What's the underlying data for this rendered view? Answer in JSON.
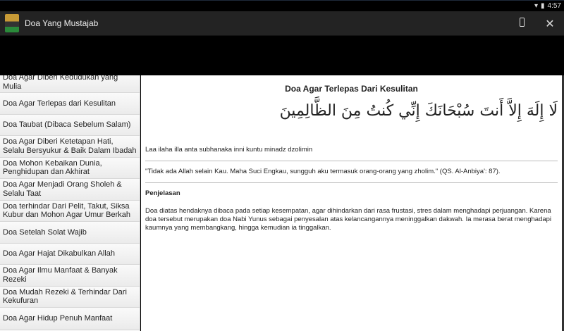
{
  "status": {
    "time": "4:57"
  },
  "app": {
    "title": "Doa Yang Mustajab"
  },
  "sidebar": {
    "items": [
      "Doa Agar Diberi Kedudukan yang Mulia",
      "Doa Agar Terlepas dari Kesulitan",
      "Doa Taubat (Dibaca Sebelum Salam)",
      "Doa Agar Diberi Ketetapan Hati, Selalu Bersyukur & Baik Dalam Ibadah",
      "Doa Mohon Kebaikan Dunia, Penghidupan dan Akhirat",
      "Doa Agar Menjadi Orang Sholeh & Selalu Taat",
      "Doa terhindar Dari Pelit, Takut, Siksa Kubur dan Mohon Agar Umur Berkah",
      "Doa Setelah Solat Wajib",
      "Doa Agar Hajat Dikabulkan Allah",
      "Doa Agar Ilmu Manfaat & Banyak Rezeki",
      "Doa Mudah Rezeki & Terhindar Dari Kekufuran",
      "Doa Agar Hidup Penuh Manfaat"
    ]
  },
  "detail": {
    "title": "Doa Agar Terlepas Dari Kesulitan",
    "arabic": "لَا إِلَهَ إِلاَّ أَنتَ سُبْحَانَكَ إِنِّي كُنتُ مِنَ الظَّالِمِينَ",
    "latin": "Laa ilaha illa anta subhanaka inni kuntu minadz dzolimin",
    "translation": "\"Tidak ada Allah selain Kau. Maha Suci Engkau, sungguh aku termasuk orang-orang yang zholim.\" (QS. Al-Anbiya': 87).",
    "explanation_heading": "Penjelasan",
    "explanation": "Doa diatas hendaknya dibaca pada setiap kesempatan, agar dihindarkan dari rasa frustasi, stres dalam menghadapi perjuangan. Karena doa tersebut merupakan doa Nabi Yunus sebagai penyesalan atas kelancangannya meninggalkan dakwah. Ia merasa berat menghadapi kaumnya yang membangkang, hingga kemudian ia tinggalkan."
  }
}
